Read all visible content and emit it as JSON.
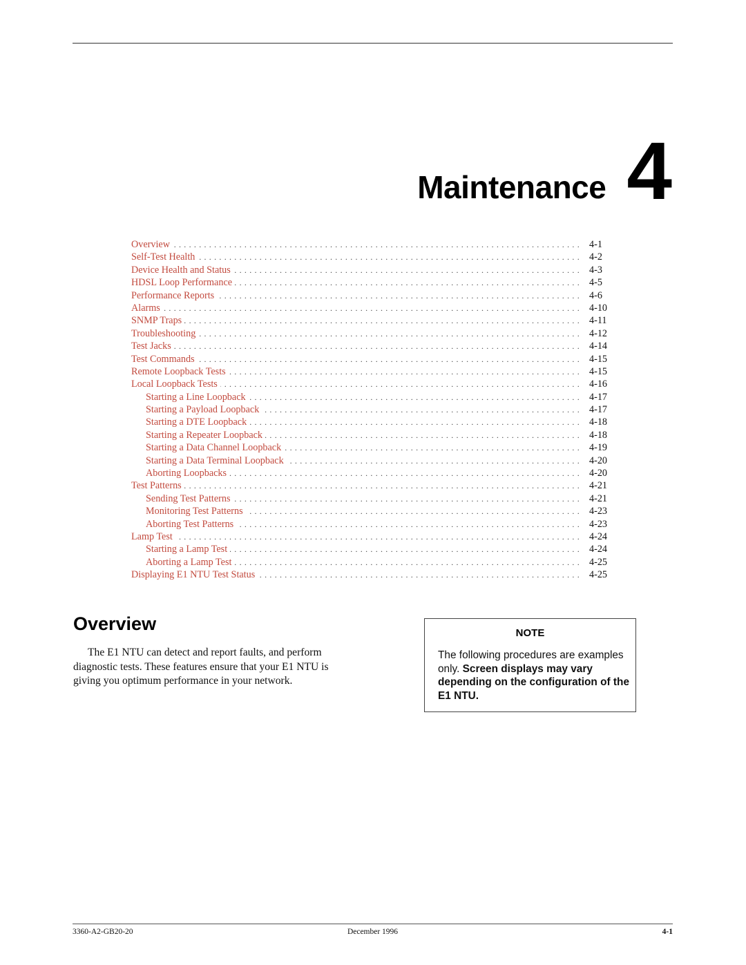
{
  "chapter": {
    "title": "Maintenance",
    "number": "4"
  },
  "toc": [
    {
      "label": "Overview",
      "page": "4-1",
      "level": 1
    },
    {
      "label": "Self-Test Health",
      "page": "4-2",
      "level": 1
    },
    {
      "label": "Device Health and Status",
      "page": "4-3",
      "level": 1
    },
    {
      "label": "HDSL Loop Performance",
      "page": "4-5",
      "level": 1
    },
    {
      "label": "Performance Reports",
      "page": "4-6",
      "level": 1
    },
    {
      "label": "Alarms",
      "page": "4-10",
      "level": 1
    },
    {
      "label": "SNMP Traps",
      "page": "4-11",
      "level": 1
    },
    {
      "label": "Troubleshooting",
      "page": "4-12",
      "level": 1
    },
    {
      "label": "Test Jacks",
      "page": "4-14",
      "level": 1
    },
    {
      "label": "Test Commands",
      "page": "4-15",
      "level": 1
    },
    {
      "label": "Remote Loopback Tests",
      "page": "4-15",
      "level": 1
    },
    {
      "label": "Local Loopback Tests",
      "page": "4-16",
      "level": 1
    },
    {
      "label": "Starting a Line Loopback",
      "page": "4-17",
      "level": 2
    },
    {
      "label": "Starting a Payload Loopback",
      "page": "4-17",
      "level": 2
    },
    {
      "label": "Starting a DTE Loopback",
      "page": "4-18",
      "level": 2
    },
    {
      "label": "Starting a Repeater Loopback",
      "page": "4-18",
      "level": 2
    },
    {
      "label": "Starting a Data Channel Loopback",
      "page": "4-19",
      "level": 2
    },
    {
      "label": "Starting a Data Terminal Loopback",
      "page": "4-20",
      "level": 2
    },
    {
      "label": "Aborting Loopbacks",
      "page": "4-20",
      "level": 2
    },
    {
      "label": "Test Patterns",
      "page": "4-21",
      "level": 1
    },
    {
      "label": "Sending Test Patterns",
      "page": "4-21",
      "level": 2
    },
    {
      "label": "Monitoring Test Patterns",
      "page": "4-23",
      "level": 2
    },
    {
      "label": "Aborting Test Patterns",
      "page": "4-23",
      "level": 2
    },
    {
      "label": "Lamp Test",
      "page": "4-24",
      "level": 1
    },
    {
      "label": "Starting a Lamp Test",
      "page": "4-24",
      "level": 2
    },
    {
      "label": "Aborting a Lamp Test",
      "page": "4-25",
      "level": 2
    },
    {
      "label": "Displaying E1 NTU Test Status",
      "page": "4-25",
      "level": 1
    }
  ],
  "toc_link_color": "#c24a3e",
  "section": {
    "title": "Overview",
    "body": "The E1 NTU can detect and report faults, and perform diagnostic tests. These features ensure that your E1 NTU is giving you optimum performance in your network."
  },
  "note": {
    "title": "NOTE",
    "text_plain": "The following procedures are examples only.",
    "text_bold": "Screen displays may vary depending on the configuration of the E1 NTU."
  },
  "footer": {
    "doc_number": "3360-A2-GB20-20",
    "date": "December 1996",
    "page": "4-1"
  }
}
